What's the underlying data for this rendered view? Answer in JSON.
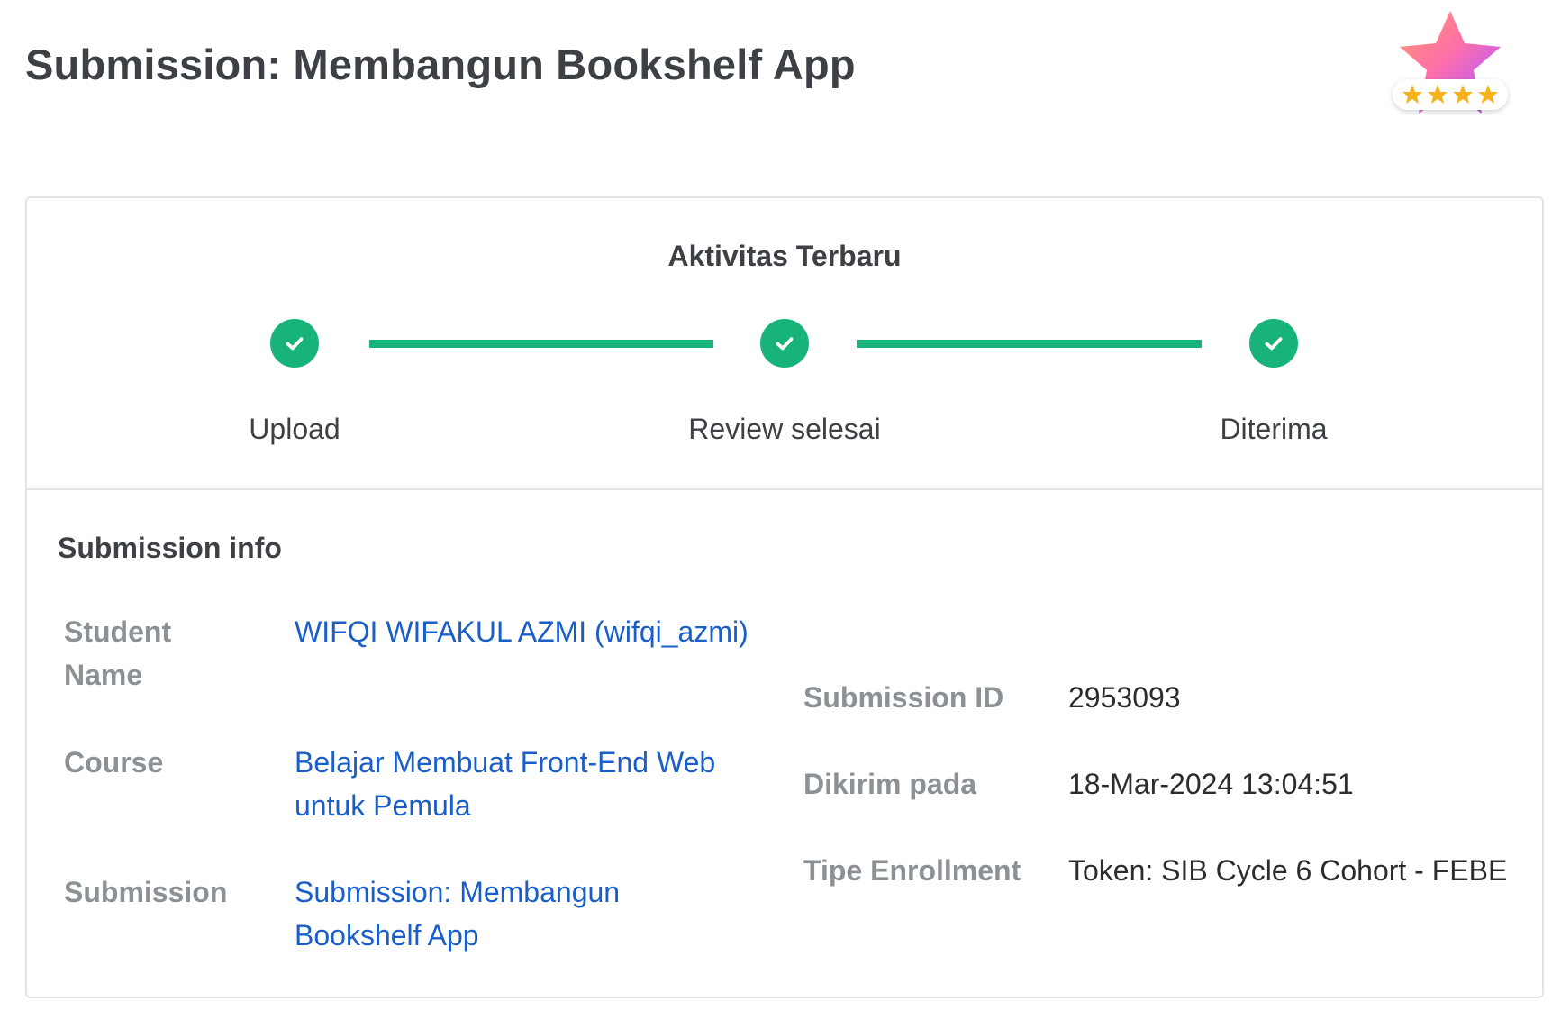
{
  "page": {
    "title": "Submission: Membangun Bookshelf App"
  },
  "badge": {
    "icon": "star-rating-badge-icon",
    "stars": 4
  },
  "activity": {
    "title": "Aktivitas Terbaru",
    "accent_color": "#17b378",
    "steps": [
      {
        "label": "Upload",
        "status": "done"
      },
      {
        "label": "Review selesai",
        "status": "done"
      },
      {
        "label": "Diterima",
        "status": "done"
      }
    ]
  },
  "submission_info": {
    "title": "Submission info",
    "student_name_label": "Student Name",
    "student_name_label_line1": "Student",
    "student_name_label_line2": "Name",
    "student_name_value": "WIFQI WIFAKUL AZMI (wifqi_azmi)",
    "course_label": "Course",
    "course_value_line1": "Belajar Membuat Front-End Web",
    "course_value_line2": "untuk Pemula",
    "submission_label": "Submission",
    "submission_value_line1": "Submission: Membangun",
    "submission_value_line2": "Bookshelf App",
    "submission_id_label": "Submission ID",
    "submission_id_value": "2953093",
    "sent_label": "Dikirim pada",
    "sent_value": "18-Mar-2024 13:04:51",
    "enrollment_label": "Tipe Enrollment",
    "enrollment_value": "Token: SIB Cycle 6 Cohort - FEBE"
  }
}
